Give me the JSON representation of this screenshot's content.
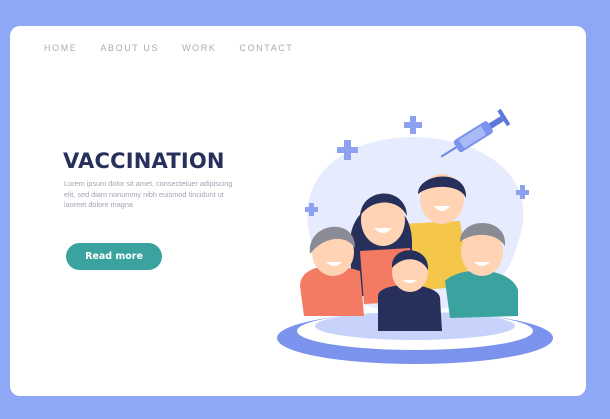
{
  "nav": {
    "items": [
      {
        "label": "HOME"
      },
      {
        "label": "ABOUT US"
      },
      {
        "label": "WORK"
      },
      {
        "label": "CONTACT"
      }
    ]
  },
  "hero": {
    "title": "VACCINATION",
    "description": "Lorem ipsum dolor sit amet, consectetuer adipiscing elit, sed diam nonummy nibh euismod tincidunt ut laoreet dolore magna",
    "cta_label": "Read more"
  },
  "illustration": {
    "icons": [
      "syringe-icon",
      "medical-cross-icon",
      "family-illustration"
    ]
  },
  "colors": {
    "background": "#8fa8f5",
    "card": "#ffffff",
    "title": "#27305a",
    "button": "#3aa3a0",
    "accent_blue": "#6f86e8"
  }
}
